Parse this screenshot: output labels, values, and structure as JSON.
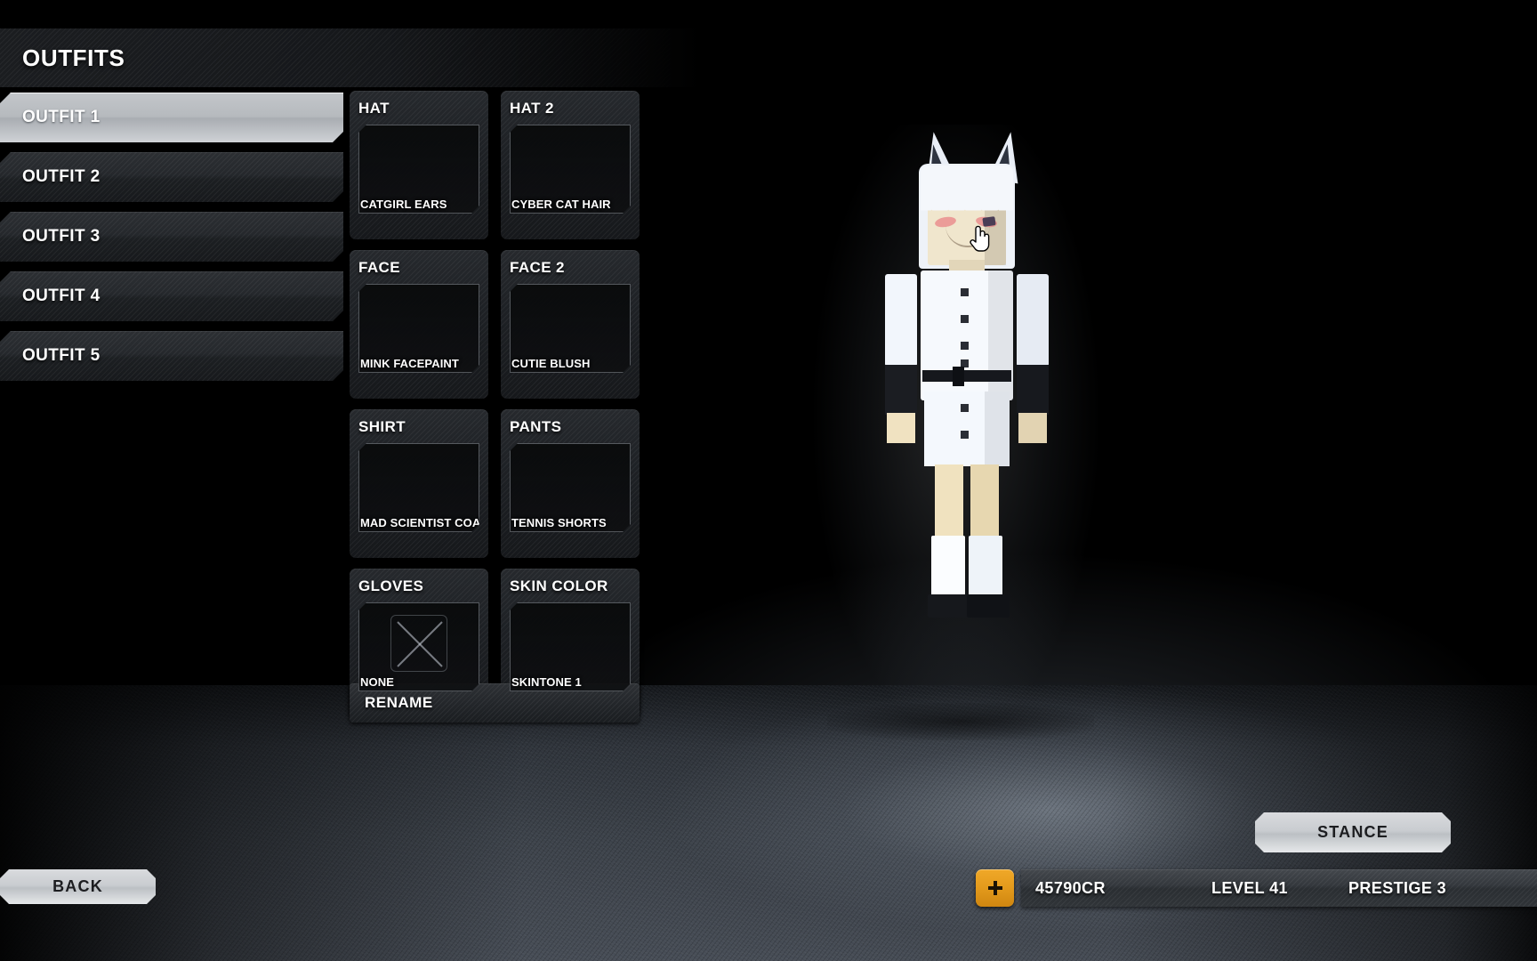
{
  "header": {
    "title": "OUTFITS"
  },
  "sidebar": {
    "items": [
      {
        "label": "OUTFIT 1",
        "selected": true
      },
      {
        "label": "OUTFIT 2",
        "selected": false
      },
      {
        "label": "OUTFIT 3",
        "selected": false
      },
      {
        "label": "OUTFIT 4",
        "selected": false
      },
      {
        "label": "OUTFIT 5",
        "selected": false
      }
    ]
  },
  "slots": [
    {
      "title": "HAT",
      "value": "CATGIRL EARS",
      "empty": false
    },
    {
      "title": "HAT 2",
      "value": "CYBER CAT HAIR",
      "empty": false
    },
    {
      "title": "FACE",
      "value": "MINK FACEPAINT",
      "empty": false
    },
    {
      "title": "FACE 2",
      "value": "CUTIE BLUSH",
      "empty": false
    },
    {
      "title": "SHIRT",
      "value": "MAD SCIENTIST COAT",
      "empty": false
    },
    {
      "title": "PANTS",
      "value": "TENNIS SHORTS",
      "empty": false
    },
    {
      "title": "GLOVES",
      "value": "NONE",
      "empty": true
    },
    {
      "title": "SKIN COLOR",
      "value": "SKINTONE 1",
      "empty": false
    }
  ],
  "buttons": {
    "rename": "RENAME",
    "back": "BACK",
    "stance": "STANCE",
    "add_credits_icon": "plus-icon"
  },
  "hud": {
    "credits": "45790CR",
    "level": "LEVEL 41",
    "prestige": "PRESTIGE 3"
  },
  "cursor": {
    "icon": "pointing-hand-cursor"
  },
  "colors": {
    "accent_orange": "#e39a1c",
    "panel_dark": "#1e2125",
    "selected_light": "#c3c6ca",
    "text_light": "#ffffff"
  }
}
